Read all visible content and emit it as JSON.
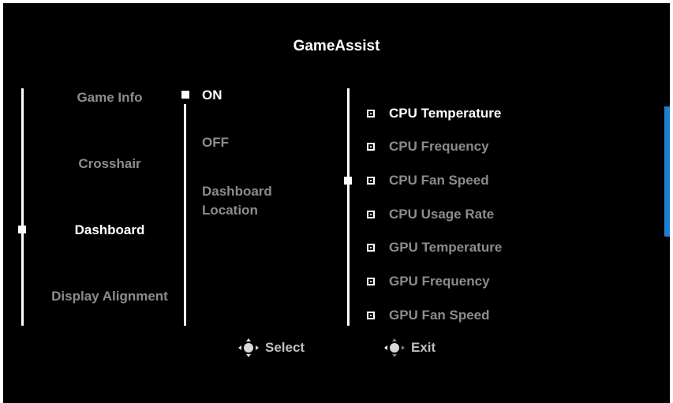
{
  "title": "GameAssist",
  "left_menu": [
    {
      "label": "Game Info",
      "active": false
    },
    {
      "label": "Crosshair",
      "active": false
    },
    {
      "label": "Dashboard",
      "active": true
    },
    {
      "label": "Display Alignment",
      "active": false
    }
  ],
  "mid_menu": [
    {
      "label": "ON",
      "active": true
    },
    {
      "label": "OFF",
      "active": false
    },
    {
      "label": "Dashboard Location",
      "active": false
    }
  ],
  "right_menu": [
    {
      "label": "CPU Temperature",
      "active": true
    },
    {
      "label": "CPU Frequency",
      "active": false
    },
    {
      "label": "CPU Fan Speed",
      "active": false
    },
    {
      "label": "CPU Usage Rate",
      "active": false
    },
    {
      "label": "GPU Temperature",
      "active": false
    },
    {
      "label": "GPU Frequency",
      "active": false
    },
    {
      "label": "GPU Fan Speed",
      "active": false
    }
  ],
  "footer": {
    "select_label": "Select",
    "exit_label": "Exit",
    "select_icon": "joystick-press-icon",
    "exit_icon": "joystick-left-icon"
  },
  "colors": {
    "background": "#000000",
    "active_text": "#ffffff",
    "inactive_text": "#8c8c8c",
    "scrollbar": "#1e7fd0"
  }
}
